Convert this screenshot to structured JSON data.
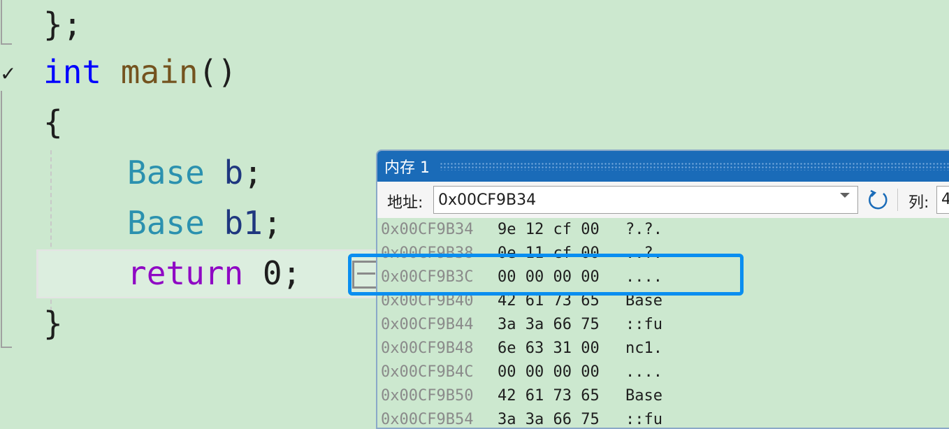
{
  "editor": {
    "lines": [
      {
        "id": "close-struct",
        "tokens": [
          {
            "t": "};",
            "c": "punc"
          }
        ]
      },
      {
        "id": "main-decl",
        "tokens": [
          {
            "t": "int",
            "c": "kw"
          },
          {
            "t": " ",
            "c": "punc"
          },
          {
            "t": "main",
            "c": "fn"
          },
          {
            "t": "()",
            "c": "punc"
          }
        ]
      },
      {
        "id": "open-brace",
        "tokens": [
          {
            "t": "{",
            "c": "punc"
          }
        ]
      },
      {
        "id": "decl-b",
        "tokens": [
          {
            "t": "Base",
            "c": "type"
          },
          {
            "t": " ",
            "c": "punc"
          },
          {
            "t": "b",
            "c": "var"
          },
          {
            "t": ";",
            "c": "punc"
          }
        ]
      },
      {
        "id": "decl-b1",
        "tokens": [
          {
            "t": "Base",
            "c": "type"
          },
          {
            "t": " ",
            "c": "punc"
          },
          {
            "t": "b1",
            "c": "var"
          },
          {
            "t": ";",
            "c": "punc"
          }
        ]
      },
      {
        "id": "return-line",
        "tokens": [
          {
            "t": "return",
            "c": "ctl"
          },
          {
            "t": " 0;",
            "c": "punc"
          }
        ]
      },
      {
        "id": "close-brace",
        "tokens": [
          {
            "t": "}",
            "c": "punc"
          }
        ]
      }
    ],
    "colors": {
      "keyword": "#0000ff",
      "function": "#74531f",
      "type": "#2b91af",
      "variable": "#1f377f",
      "control": "#8f08c4",
      "background": "#cce8cf"
    }
  },
  "memory_window": {
    "title": "内存 1",
    "address_label": "地址:",
    "address_value": "0x00CF9B34",
    "column_label": "列:",
    "column_value": "4",
    "rows": [
      {
        "addr": "0x00CF9B34",
        "bytes": "9e 12 cf 00",
        "ascii": "?.?."
      },
      {
        "addr": "0x00CF9B38",
        "bytes": "0e 11 cf 00",
        "ascii": "..?."
      },
      {
        "addr": "0x00CF9B3C",
        "bytes": "00 00 00 00",
        "ascii": "...."
      },
      {
        "addr": "0x00CF9B40",
        "bytes": "42 61 73 65",
        "ascii": "Base"
      },
      {
        "addr": "0x00CF9B44",
        "bytes": "3a 3a 66 75",
        "ascii": "::fu"
      },
      {
        "addr": "0x00CF9B48",
        "bytes": "6e 63 31 00",
        "ascii": "nc1."
      },
      {
        "addr": "0x00CF9B4C",
        "bytes": "00 00 00 00",
        "ascii": "...."
      },
      {
        "addr": "0x00CF9B50",
        "bytes": "42 61 73 65",
        "ascii": "Base"
      },
      {
        "addr": "0x00CF9B54",
        "bytes": "3a 3a 66 75",
        "ascii": "::fu"
      }
    ],
    "highlight_color": "#0a8ef0",
    "titlebar_color": "#1a6bb8"
  }
}
